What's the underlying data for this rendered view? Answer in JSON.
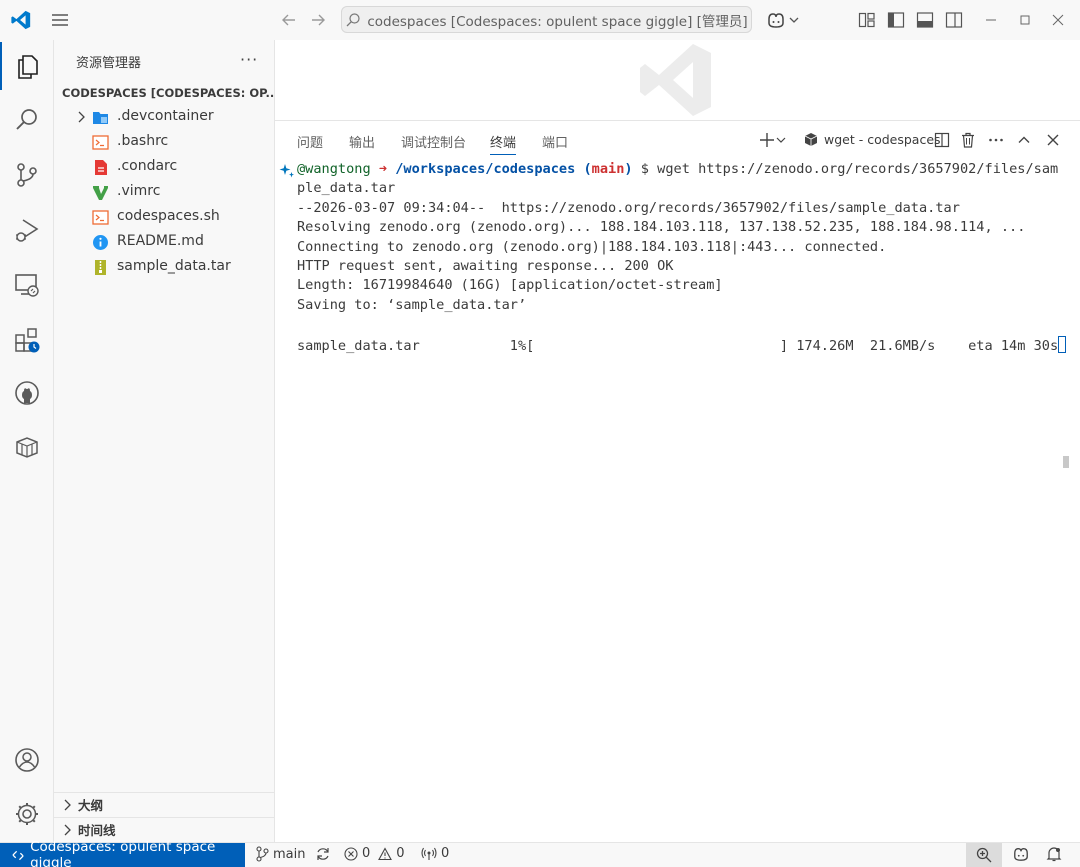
{
  "titlebar": {
    "search_text": "codespaces [Codespaces: opulent space giggle] [管理员]",
    "icons": [
      "vscode-logo-icon",
      "menu-icon",
      "back-arrow-icon",
      "forward-arrow-icon",
      "search-icon",
      "copilot-icon",
      "chevron-down-icon",
      "customize-layout-icon",
      "toggle-sidebar-icon",
      "toggle-panel-icon",
      "toggle-secondary-sidebar-icon",
      "minimize-icon",
      "maximize-icon",
      "close-icon"
    ]
  },
  "activitybar": {
    "items": [
      "explorer-icon",
      "search-icon",
      "source-control-icon",
      "run-debug-icon",
      "remote-explorer-icon",
      "extensions-icon",
      "github-icon",
      "containers-icon"
    ],
    "bottom": [
      "accounts-icon",
      "settings-gear-icon"
    ]
  },
  "sidebar": {
    "title": "资源管理器",
    "more": "···",
    "folder_name": "CODESPACES [CODESPACES: OP...",
    "files": [
      {
        "name": ".devcontainer",
        "type": "folder"
      },
      {
        "name": ".bashrc",
        "type": "shell"
      },
      {
        "name": ".condarc",
        "type": "yaml"
      },
      {
        "name": ".vimrc",
        "type": "vim"
      },
      {
        "name": "codespaces.sh",
        "type": "shell"
      },
      {
        "name": "README.md",
        "type": "info"
      },
      {
        "name": "sample_data.tar",
        "type": "archive"
      }
    ],
    "sections": [
      "大纲",
      "时间线"
    ]
  },
  "panel": {
    "tabs": [
      "问题",
      "输出",
      "调试控制台",
      "终端",
      "端口"
    ],
    "active_tab": "终端",
    "terminal_name": "wget - codespaces"
  },
  "terminal": {
    "prompt_user": "@wangtong",
    "prompt_arrow": "➜",
    "prompt_path": "/workspaces/codespaces",
    "prompt_branch_open": "(",
    "prompt_branch": "main",
    "prompt_branch_close": ")",
    "command": " $ wget https://zenodo.org/records/3657902/files/sam",
    "lines": [
      "ple_data.tar",
      "--2026-03-07 09:34:04--  https://zenodo.org/records/3657902/files/sample_data.tar",
      "Resolving zenodo.org (zenodo.org)... 188.184.103.118, 137.138.52.235, 188.184.98.114, ...",
      "Connecting to zenodo.org (zenodo.org)|188.184.103.118|:443... connected.",
      "HTTP request sent, awaiting response... 200 OK",
      "Length: 16719984640 (16G) [application/octet-stream]",
      "Saving to: ‘sample_data.tar’",
      "",
      "sample_data.tar           1%[                              ] 174.26M  21.6MB/s    eta 14m 30s"
    ]
  },
  "statusbar": {
    "remote": "Codespaces: opulent space giggle",
    "branch": "main",
    "errors": "0",
    "warnings": "0",
    "ports": "0"
  }
}
